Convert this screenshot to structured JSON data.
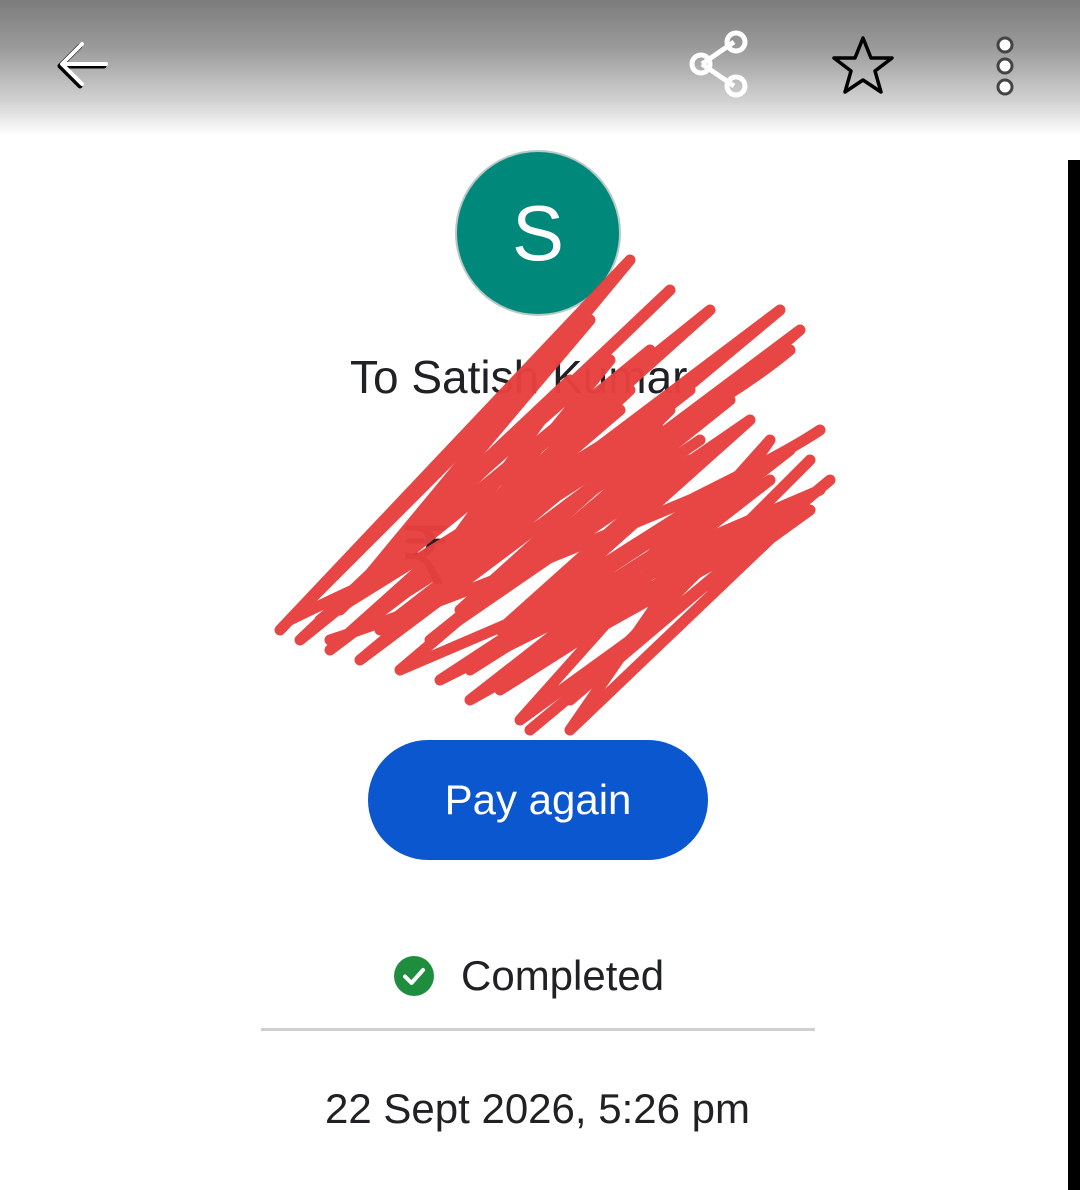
{
  "avatar": {
    "initial": "S",
    "color": "#00897b"
  },
  "payment": {
    "recipient": "To Satish Kumar",
    "amount": "₹"
  },
  "actions": {
    "pay_again": "Pay again"
  },
  "status": {
    "label": "Completed",
    "color": "#1e8e3e"
  },
  "datetime": "22 Sept 2026, 5:26 pm",
  "icons": [
    "back-arrow-icon",
    "share-icon",
    "star-icon",
    "more-vert-icon",
    "check-circle-icon"
  ],
  "colors": {
    "button": "#0b57d0",
    "redaction": "#e8403f"
  }
}
